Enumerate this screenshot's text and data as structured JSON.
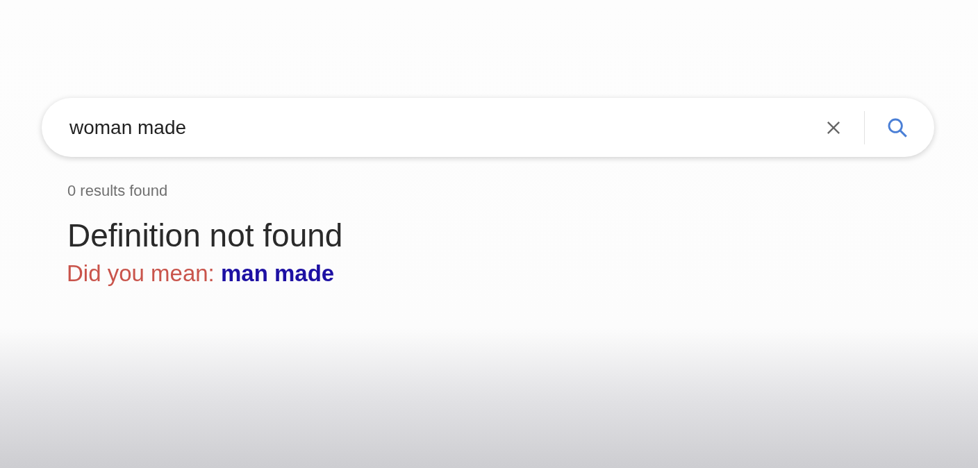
{
  "search": {
    "value": "woman made"
  },
  "results_count": "0 results found",
  "heading": "Definition not found",
  "suggestion": {
    "prefix": "Did you mean:",
    "link": "man made"
  }
}
